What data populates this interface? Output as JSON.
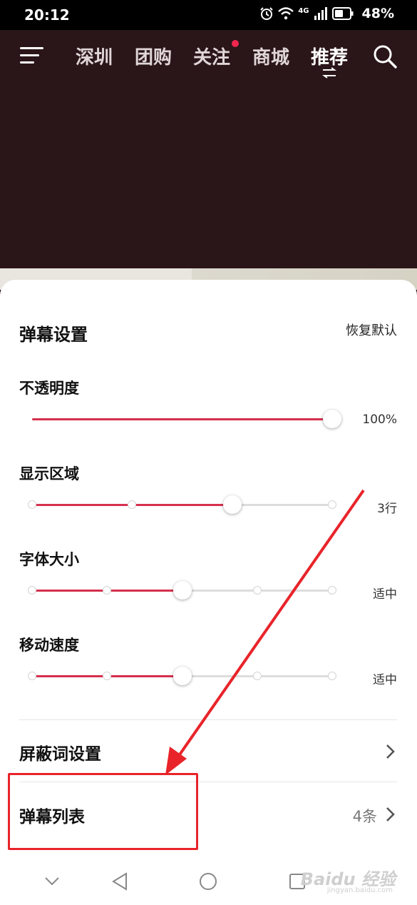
{
  "status_bar": {
    "time": "20:12",
    "network": "4G",
    "battery": "48%"
  },
  "nav": {
    "tabs": [
      {
        "label": "深圳",
        "active": false
      },
      {
        "label": "团购",
        "active": false
      },
      {
        "label": "关注",
        "active": false,
        "has_dot": true
      },
      {
        "label": "商城",
        "active": false
      },
      {
        "label": "推荐",
        "active": true
      }
    ],
    "icons": [
      "menu-icon",
      "swap-icon",
      "search-icon"
    ]
  },
  "sheet": {
    "title": "弹幕设置",
    "reset_label": "恢复默认",
    "settings": [
      {
        "label": "不透明度",
        "value": "100%",
        "level": 1.0,
        "steps": 0
      },
      {
        "label": "显示区域",
        "value": "3行",
        "level": 0.667,
        "steps": 4
      },
      {
        "label": "字体大小",
        "value": "适中",
        "level": 0.5,
        "steps": 5
      },
      {
        "label": "移动速度",
        "value": "适中",
        "level": 0.5,
        "steps": 5
      }
    ],
    "blocked_words": {
      "label": "屏蔽词设置"
    },
    "danmaku_list": {
      "label": "弹幕列表",
      "count": "4条"
    }
  },
  "watermark": {
    "brand": "Baidu 经验",
    "url": "jingyan.baidu.com"
  },
  "colors": {
    "accent": "#d6304e",
    "annotation": "#e8242a",
    "dot": "#f0264f"
  }
}
